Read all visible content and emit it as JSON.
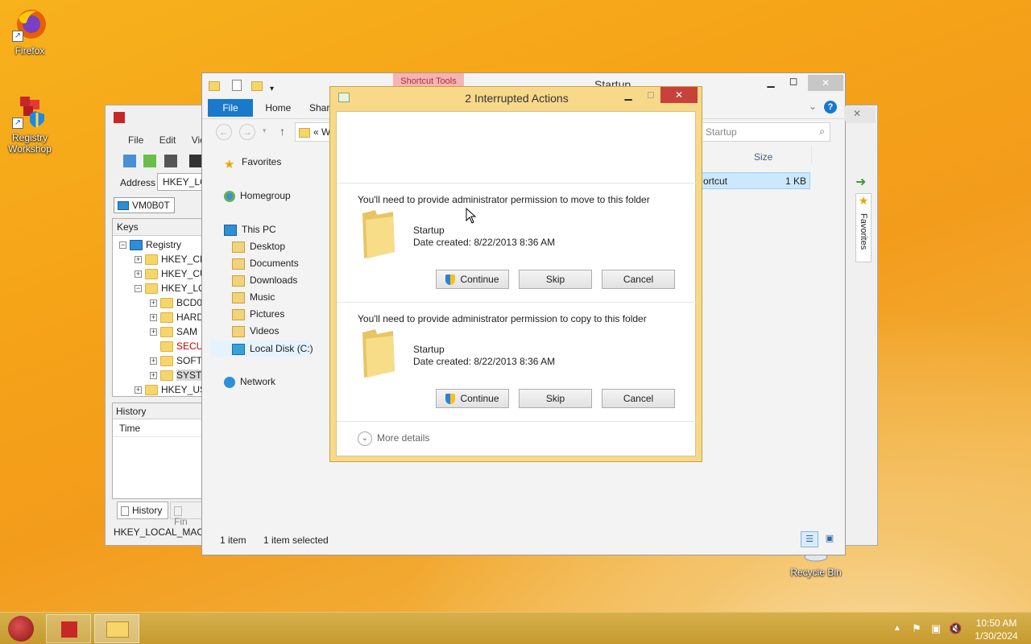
{
  "desktop": {
    "icons": [
      {
        "label": "Firefox"
      },
      {
        "label": "Registry Workshop"
      },
      {
        "label": "Recycle Bin"
      }
    ]
  },
  "registry": {
    "menu": [
      "File",
      "Edit",
      "View"
    ],
    "address_label": "Address",
    "address_value": "HKEY_LO",
    "machine_tab": "VM0B0T",
    "keys_header": "Keys",
    "tree": [
      {
        "label": "Registry",
        "level": 0
      },
      {
        "label": "HKEY_CL",
        "level": 1
      },
      {
        "label": "HKEY_CU",
        "level": 1
      },
      {
        "label": "HKEY_LO",
        "level": 1
      },
      {
        "label": "BCD0",
        "level": 2
      },
      {
        "label": "HARD",
        "level": 2
      },
      {
        "label": "SAM",
        "level": 2
      },
      {
        "label": "SECU",
        "level": 2
      },
      {
        "label": "SOFT",
        "level": 2
      },
      {
        "label": "SYSTE",
        "level": 2
      },
      {
        "label": "HKEY_US",
        "level": 1
      }
    ],
    "history_header": "History",
    "time_col": "Time",
    "bottom_tabs": [
      "History",
      "Fin"
    ],
    "status": "HKEY_LOCAL_MACH"
  },
  "explorer": {
    "title": "Startup",
    "ribbon_highlight": "Shortcut Tools",
    "tabs": [
      "File",
      "Home",
      "Shar"
    ],
    "breadcrumb": "«  W",
    "search_placeholder": "Startup",
    "size_col": "Size",
    "file_name": "ortcut",
    "file_size": "1 KB",
    "nav": {
      "favorites": "Favorites",
      "favorites_items": [
        "Desktop",
        "Documents",
        "Downloads",
        "Music",
        "Pictures",
        "Videos",
        "Local Disk (C:)"
      ],
      "homegroup": "Homegroup",
      "thispc": "This PC",
      "network": "Network"
    },
    "status_items": "1 item",
    "status_selected": "1 item selected",
    "favorites_side": "Favorites"
  },
  "dialog": {
    "title": "2 Interrupted Actions",
    "actions": [
      {
        "message": "You'll need to provide administrator permission to move to this folder",
        "folder_name": "Startup",
        "date": "Date created: 8/22/2013 8:36 AM",
        "continue": "Continue",
        "skip": "Skip",
        "cancel": "Cancel"
      },
      {
        "message": "You'll need to provide administrator permission to copy to this folder",
        "folder_name": "Startup",
        "date": "Date created: 8/22/2013 8:36 AM",
        "continue": "Continue",
        "skip": "Skip",
        "cancel": "Cancel"
      }
    ],
    "more_details": "More details"
  },
  "taskbar": {
    "time": "10:50 AM",
    "date": "1/30/2024"
  },
  "colors": {
    "accent": "#1979ca",
    "dialog_frame": "#f8d98a",
    "close_red": "#c7423a",
    "registry_red": "#c00000"
  }
}
